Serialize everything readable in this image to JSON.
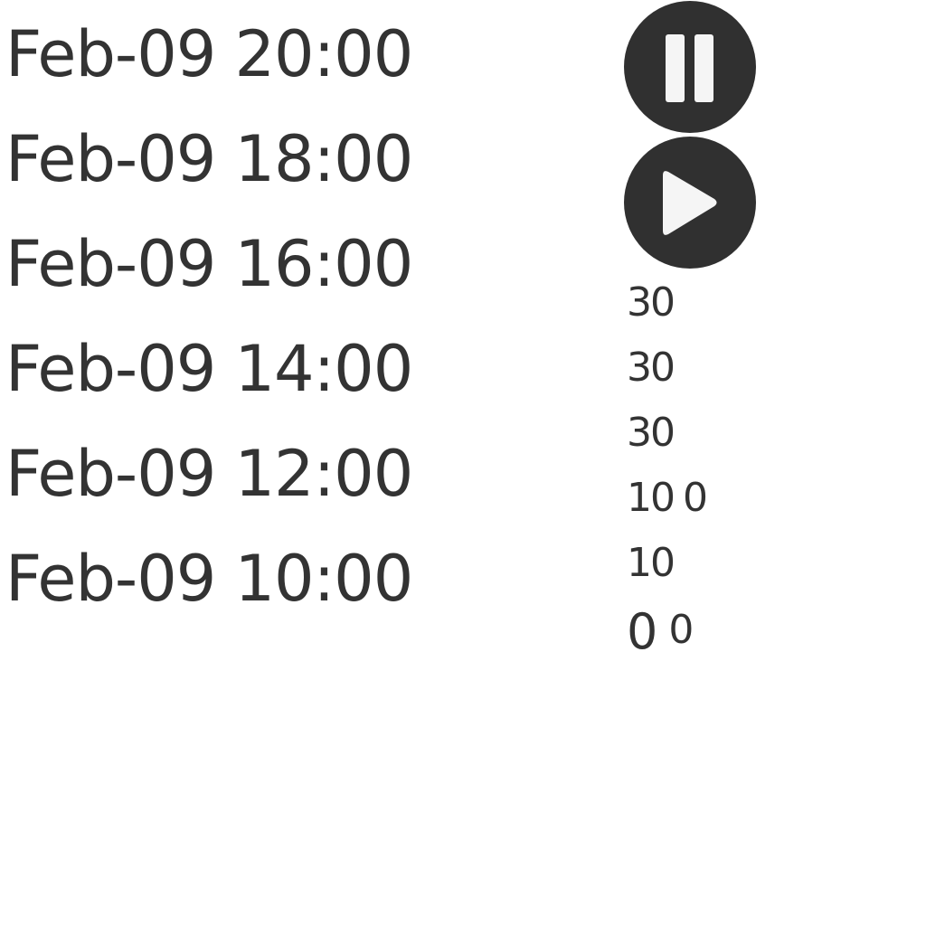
{
  "times": [
    "Feb-09 20:00",
    "Feb-09 18:00",
    "Feb-09 16:00",
    "Feb-09 14:00",
    "Feb-09 12:00",
    "Feb-09 10:00"
  ],
  "controls": {
    "pause_icon": "pause-icon",
    "play_icon": "play-icon",
    "button_color": "#303030",
    "icon_color": "#f5f5f5"
  },
  "values": [
    {
      "main": "30",
      "extra": ""
    },
    {
      "main": "30",
      "extra": ""
    },
    {
      "main": "30",
      "extra": ""
    },
    {
      "main": "10",
      "extra": "0"
    },
    {
      "main": "10",
      "extra": ""
    },
    {
      "main": "0",
      "extra": "0"
    }
  ]
}
